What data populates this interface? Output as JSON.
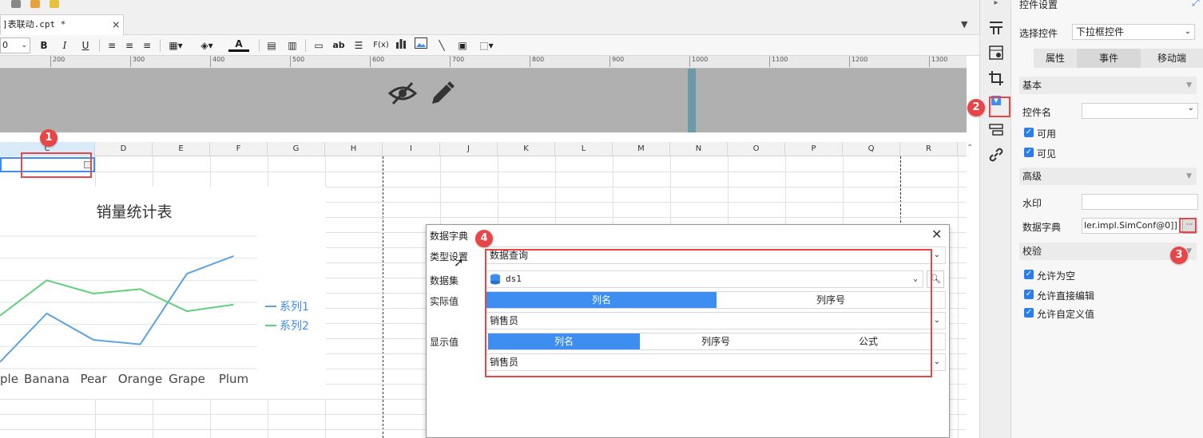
{
  "tab": {
    "title": "]表联动.cpt *",
    "close": "×"
  },
  "toolbar": {
    "font_size": "0",
    "bold": "B",
    "italic": "I",
    "underline": "U",
    "font_color_label": "A",
    "text_ab": "ab",
    "formula_label": "F(x)"
  },
  "ruler": {
    "ticks": [
      "200",
      "300",
      "400",
      "500",
      "600",
      "700",
      "800",
      "900",
      "1000",
      "1100",
      "1200",
      "1300"
    ]
  },
  "sheet": {
    "columns": [
      "C",
      "D",
      "E",
      "F",
      "G",
      "H",
      "I",
      "J",
      "K",
      "L",
      "M",
      "N",
      "O",
      "P",
      "Q",
      "R"
    ]
  },
  "chart_data": {
    "type": "line",
    "title": "销量统计表",
    "categories": [
      "ple",
      "Banana",
      "Pear",
      "Orange",
      "Grape",
      "Plum"
    ],
    "series": [
      {
        "name": "系列1",
        "values": [
          0.3,
          2.5,
          1.3,
          1.1,
          4.3,
          5.1
        ],
        "color": "#5ba3e0"
      },
      {
        "name": "系列2",
        "values": [
          2.4,
          4.0,
          3.4,
          3.6,
          2.6,
          2.9
        ],
        "color": "#5fd07a"
      }
    ],
    "ylim": [
      0,
      6
    ],
    "grid": true,
    "legend": "right"
  },
  "panel": {
    "title": "控件设置",
    "select_label": "选择控件",
    "select_value": "下拉框控件",
    "tabs": [
      "属性",
      "事件",
      "移动端"
    ],
    "sections": {
      "basic": "基本",
      "advanced": "高级",
      "validate": "校验"
    },
    "fields": {
      "name_label": "控件名",
      "enabled_label": "可用",
      "visible_label": "可见",
      "watermark_label": "水印",
      "dict_label": "数据字典",
      "dict_value": "ler.impl.SimConf@0]]",
      "dict_btn": "···",
      "allow_empty": "允许为空",
      "allow_edit": "允许直接编辑",
      "allow_custom": "允许自定义值"
    }
  },
  "dialog": {
    "title": "数据字典",
    "close": "✕",
    "type_label": "类型设置",
    "type_value": "数据查询",
    "dataset_label": "数据集",
    "dataset_value": "ds1",
    "actual_label": "实际值",
    "actual_tabs": [
      "列名",
      "列序号"
    ],
    "actual_value": "销售员",
    "display_label": "显示值",
    "display_tabs": [
      "列名",
      "列序号",
      "公式"
    ],
    "display_value": "销售员"
  },
  "badges": [
    "1",
    "2",
    "3",
    "4"
  ],
  "colors": {
    "accent": "#3d8ef0",
    "highlight": "#e84646",
    "checkbox": "#2b7de9"
  }
}
